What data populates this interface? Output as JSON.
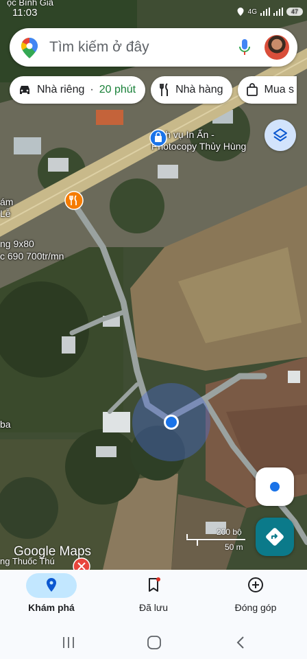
{
  "status_bar": {
    "time": "11:03",
    "top_label": "ọc Bình Giã",
    "network": "4G",
    "battery": "47"
  },
  "search": {
    "placeholder": "Tìm kiếm ở đây",
    "icons": [
      "maps-pin-icon",
      "mic-icon",
      "avatar"
    ]
  },
  "chips": [
    {
      "icon": "car-icon",
      "label": "Nhà riêng",
      "separator": "·",
      "duration": "20 phút"
    },
    {
      "icon": "restaurant-icon",
      "label": "Nhà hàng"
    },
    {
      "icon": "shopping-bag-icon",
      "label": "Mua s"
    }
  ],
  "map": {
    "poi_print": {
      "name_line1": "Dịch vụ In Ấn -",
      "name_line2": "Photocopy Thủy Hùng",
      "icon": "shopping-icon"
    },
    "labels": {
      "left_top_1": "ám",
      "left_top_2": "Lễ",
      "ad_line1": "ng 9x80",
      "ad_line2": "c 690 700tr/mn",
      "left_mid": "ba",
      "bottom": "ng Thuốc Thú"
    },
    "scale": {
      "top": "200 bộ",
      "bottom": "50 m"
    },
    "watermark": "Google Maps"
  },
  "controls": {
    "layers": "layers-icon",
    "my_location": "my-location-icon",
    "directions": "directions-icon"
  },
  "bottom_nav": [
    {
      "label": "Khám phá",
      "icon": "explore-pin-icon",
      "active": true
    },
    {
      "label": "Đã lưu",
      "icon": "bookmark-icon",
      "active": false
    },
    {
      "label": "Đóng góp",
      "icon": "add-circle-icon",
      "active": false
    }
  ],
  "colors": {
    "accent": "#1a73e8",
    "chip_duration": "#188038",
    "nav_active": "#c2e7ff",
    "directions": "#0b7a8a"
  }
}
